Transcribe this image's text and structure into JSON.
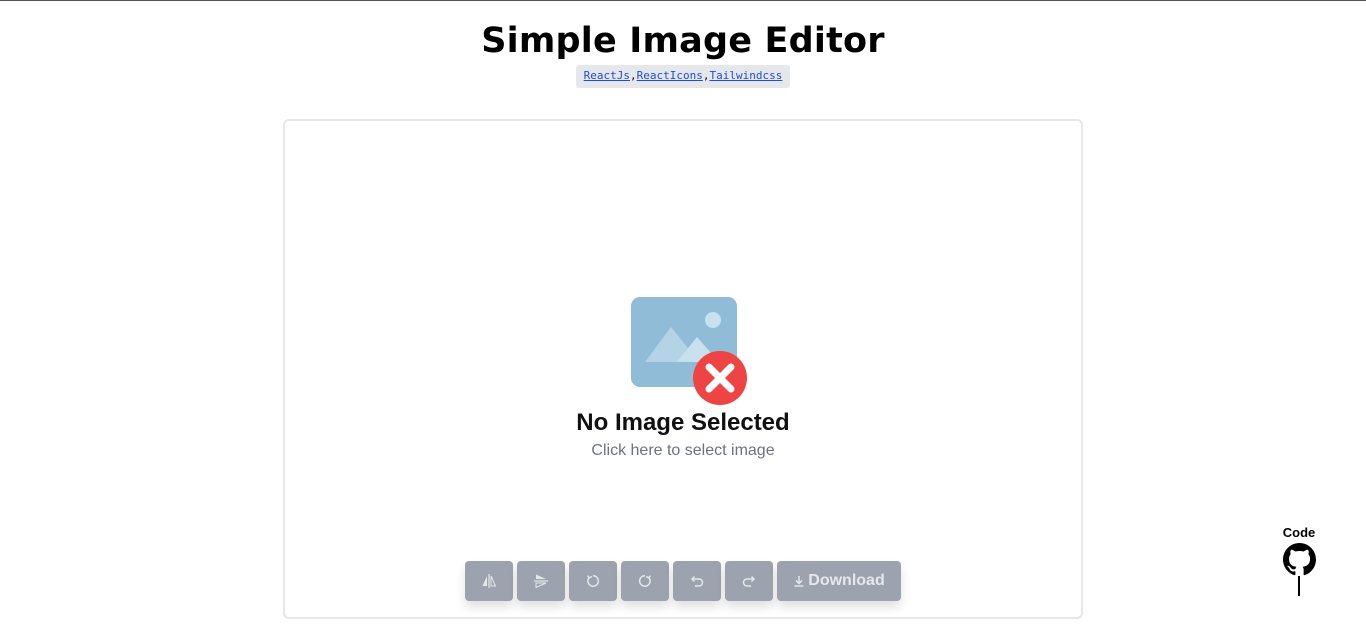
{
  "header": {
    "title": "Simple Image Editor",
    "tech": [
      {
        "label": "ReactJs"
      },
      {
        "label": "ReactIcons"
      },
      {
        "label": "Tailwindcss"
      }
    ],
    "separator": ","
  },
  "editor": {
    "empty_title": "No Image Selected",
    "empty_subtitle": "Click here to select image",
    "placeholder_icon": "image-error-icon",
    "toolbar": [
      {
        "name": "flip-horizontal",
        "icon": "flip-horizontal-icon"
      },
      {
        "name": "flip-vertical",
        "icon": "flip-vertical-icon"
      },
      {
        "name": "rotate-left",
        "icon": "rotate-left-icon"
      },
      {
        "name": "rotate-right",
        "icon": "rotate-right-icon"
      },
      {
        "name": "undo",
        "icon": "undo-icon"
      },
      {
        "name": "redo",
        "icon": "redo-icon"
      }
    ],
    "download_label": "Download",
    "download_icon": "download-icon"
  },
  "footer": {
    "code_label": "Code",
    "code_icon": "github-icon"
  },
  "colors": {
    "button_disabled": "#9ca3af",
    "badge_bg": "#e5e7eb",
    "link": "#1d4ed8",
    "placeholder_blue": "#90bcd8",
    "error_red": "#ef4444"
  }
}
